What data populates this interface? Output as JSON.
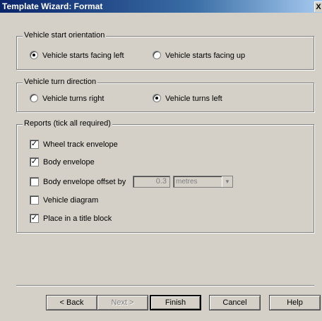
{
  "window": {
    "title": "Template Wizard: Format",
    "close_glyph": "X"
  },
  "orientation": {
    "label": "Vehicle start orientation",
    "options": [
      {
        "label": "Vehicle starts facing left",
        "selected": true
      },
      {
        "label": "Vehicle starts facing up",
        "selected": false
      }
    ]
  },
  "turn": {
    "label": "Vehicle turn direction",
    "options": [
      {
        "label": "Vehicle turns right",
        "selected": false
      },
      {
        "label": "Vehicle turns left",
        "selected": true
      }
    ]
  },
  "reports": {
    "label": "Reports (tick all required)",
    "items": [
      {
        "label": "Wheel track envelope",
        "checked": true
      },
      {
        "label": "Body envelope",
        "checked": true
      },
      {
        "label": "Body envelope offset by",
        "checked": false
      },
      {
        "label": "Vehicle diagram",
        "checked": false
      },
      {
        "label": "Place in a title block",
        "checked": true
      }
    ],
    "offset_value": "0.3",
    "offset_unit": "metres"
  },
  "buttons": {
    "back": "< Back",
    "next": "Next >",
    "finish": "Finish",
    "cancel": "Cancel",
    "help": "Help"
  },
  "check_glyph": "✓"
}
